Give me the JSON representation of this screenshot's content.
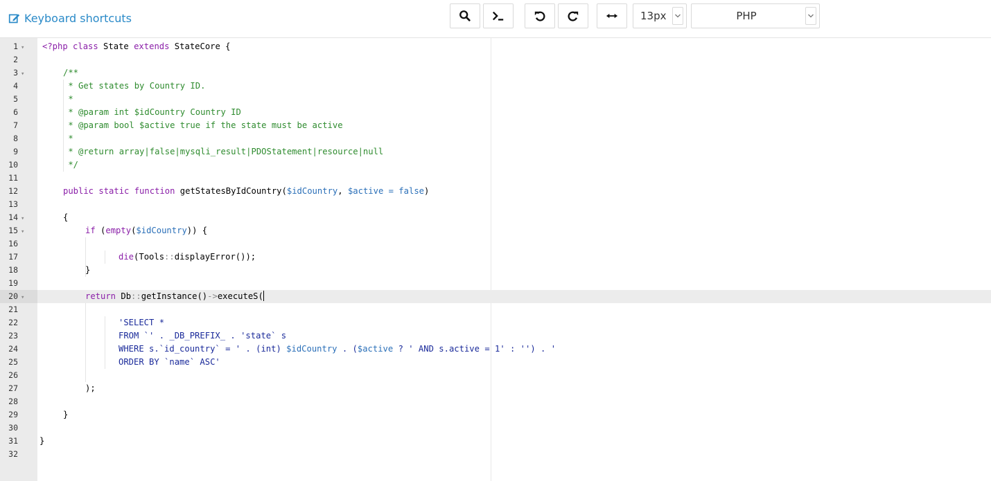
{
  "toolbar": {
    "shortcuts_label": "Keyboard shortcuts",
    "buttons": [
      {
        "name": "search-button",
        "icon": "search-icon"
      },
      {
        "name": "command-palette-button",
        "icon": "terminal-icon"
      },
      {
        "name": "undo-button",
        "icon": "undo-icon"
      },
      {
        "name": "redo-button",
        "icon": "redo-icon"
      },
      {
        "name": "wrap-toggle-button",
        "icon": "horizontal-arrows-icon"
      }
    ],
    "font_size": "13px",
    "language": "PHP"
  },
  "editor": {
    "active_line": 20,
    "lines": [
      {
        "n": "1",
        "fold": true
      },
      {
        "n": "2"
      },
      {
        "n": "3",
        "fold": true
      },
      {
        "n": "4"
      },
      {
        "n": "5"
      },
      {
        "n": "6"
      },
      {
        "n": "7"
      },
      {
        "n": "8"
      },
      {
        "n": "9"
      },
      {
        "n": "10"
      },
      {
        "n": "11"
      },
      {
        "n": "12"
      },
      {
        "n": "13"
      },
      {
        "n": "14",
        "fold": true
      },
      {
        "n": "15",
        "fold": true
      },
      {
        "n": "16"
      },
      {
        "n": "17"
      },
      {
        "n": "18"
      },
      {
        "n": "19"
      },
      {
        "n": "20",
        "fold": true
      },
      {
        "n": "21"
      },
      {
        "n": "22"
      },
      {
        "n": "23"
      },
      {
        "n": "24"
      },
      {
        "n": "25"
      },
      {
        "n": "26"
      },
      {
        "n": "27"
      },
      {
        "n": "28"
      },
      {
        "n": "29"
      },
      {
        "n": "30"
      },
      {
        "n": "31"
      },
      {
        "n": "32"
      }
    ],
    "code": {
      "l1_open": "<?php ",
      "l1_class": "class",
      "l1_name": " State ",
      "l1_extends": "extends",
      "l1_parent": " StateCore {",
      "l3": "/**",
      "l4": " * Get states by Country ID.",
      "l5": " *",
      "l6": " * @param int $idCountry Country ID",
      "l7": " * @param bool $active true if the state must be active",
      "l8": " *",
      "l9": " * @return array|false|mysqli_result|PDOStatement|resource|null",
      "l10": " */",
      "l12_kw": "public static function",
      "l12_fn": " getStatesByIdCountry(",
      "l12_v1": "$idCountry",
      "l12_sep": ", ",
      "l12_v2": "$active = false",
      "l12_close": ")",
      "l14": "{",
      "l15_if": "if",
      "l15_mid": " (",
      "l15_empty": "empty",
      "l15_p": "(",
      "l15_var": "$idCountry",
      "l15_end": ")) {",
      "l17_die": "die",
      "l17_a": "(Tools",
      "l17_op": "::",
      "l17_b": "displayError());",
      "l18": "}",
      "l20_ret": "return",
      "l20_a": " Db",
      "l20_op": "::",
      "l20_b": "getInstance()",
      "l20_arrow": "->",
      "l20_c": "executeS(",
      "l22": "'SELECT *",
      "l23": "FROM `' . _DB_PREFIX_ . 'state` s",
      "l24_a": "WHERE s.`id_country` = ' . (int) ",
      "l24_v1": "$idCountry",
      "l24_b": " . (",
      "l24_v2": "$active",
      "l24_c": " ? ' AND s.active = 1' : '') . '",
      "l25": "ORDER BY `name` ASC'",
      "l27": ");",
      "l29": "}",
      "l31": "}"
    }
  }
}
